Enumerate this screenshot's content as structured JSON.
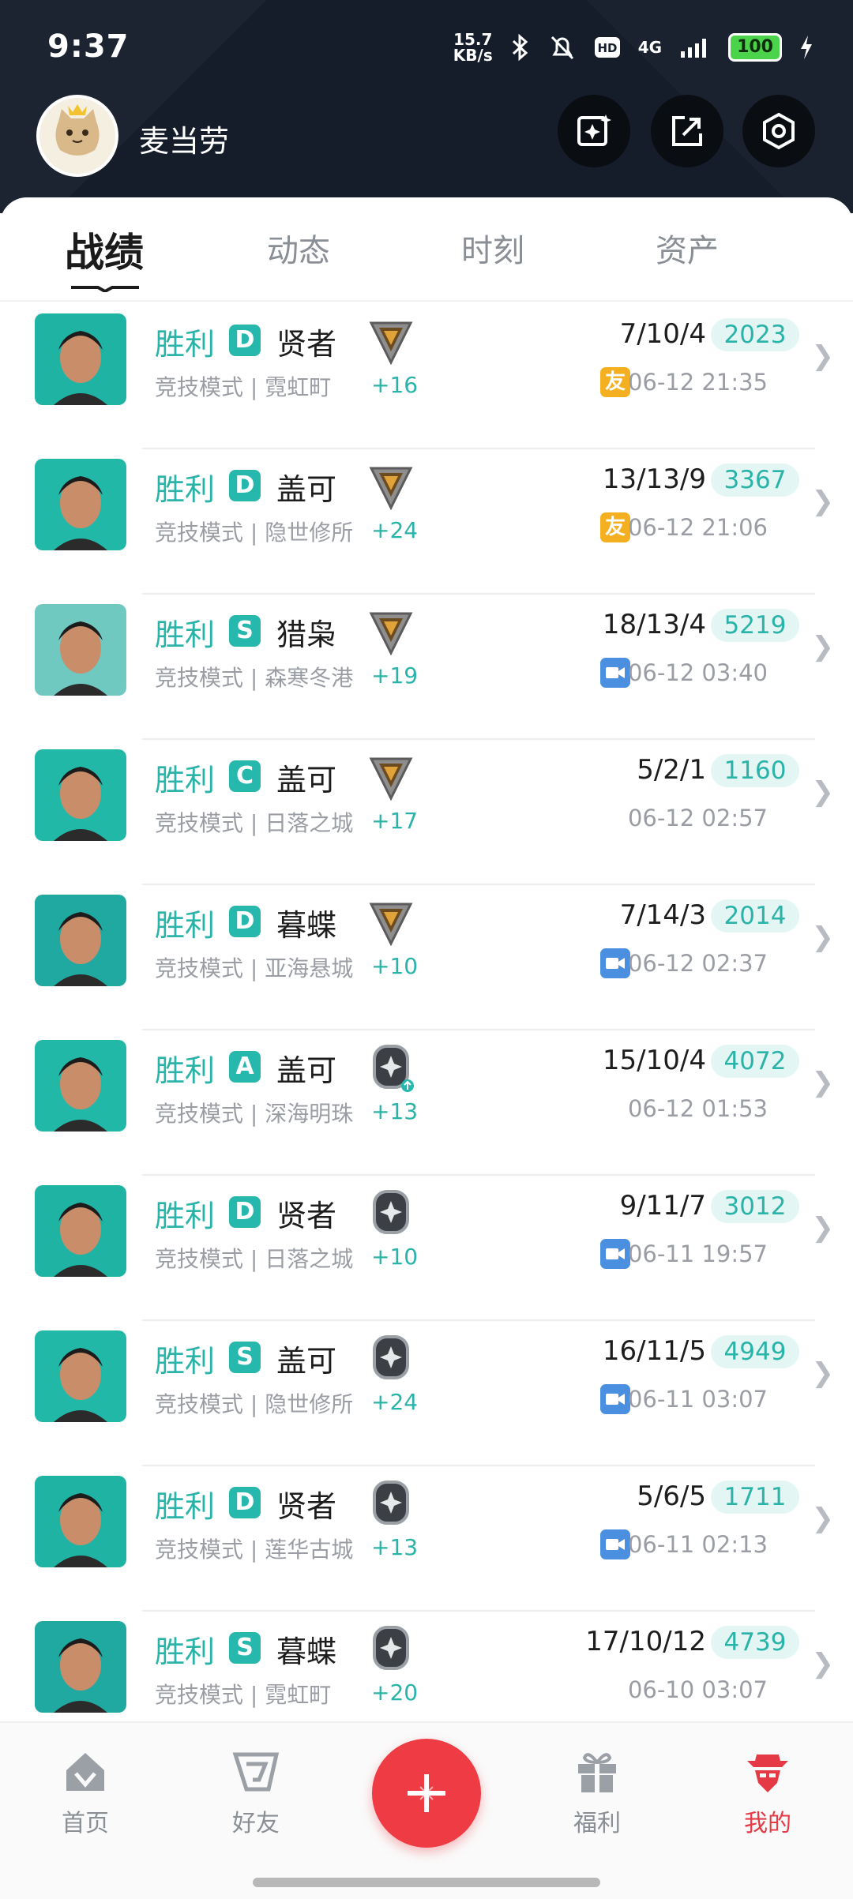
{
  "status": {
    "time": "9:37",
    "speed_value": "15.7",
    "speed_unit": "KB/s",
    "network": "4G",
    "battery": "100"
  },
  "profile": {
    "name": "麦当劳"
  },
  "tabs": [
    "战绩",
    "动态",
    "时刻",
    "资产"
  ],
  "matches": [
    {
      "result": "胜利",
      "grade": "D",
      "hero": "贤者",
      "mode": "竞技模式 | 霓虹町",
      "rank": "gold",
      "delta": "+16",
      "kda": "7/10/4",
      "score": "2023",
      "tag": "友",
      "tag_type": "friend",
      "time": "06-12 21:35",
      "hero_color": "#1fb3a3"
    },
    {
      "result": "胜利",
      "grade": "D",
      "hero": "盖可",
      "mode": "竞技模式 | 隐世修所",
      "rank": "gold",
      "delta": "+24",
      "kda": "13/13/9",
      "score": "3367",
      "tag": "友",
      "tag_type": "friend",
      "time": "06-12 21:06",
      "hero_color": "#22b8a8"
    },
    {
      "result": "胜利",
      "grade": "S",
      "hero": "猎枭",
      "mode": "竞技模式 | 森寒冬港",
      "rank": "gold",
      "delta": "+19",
      "kda": "18/13/4",
      "score": "5219",
      "tag": "",
      "tag_type": "video",
      "time": "06-12 03:40",
      "hero_color": "#6fc9c0"
    },
    {
      "result": "胜利",
      "grade": "C",
      "hero": "盖可",
      "mode": "竞技模式 | 日落之城",
      "rank": "gold",
      "delta": "+17",
      "kda": "5/2/1",
      "score": "1160",
      "tag": "",
      "tag_type": "none",
      "time": "06-12 02:57",
      "hero_color": "#22b8a8"
    },
    {
      "result": "胜利",
      "grade": "D",
      "hero": "暮蝶",
      "mode": "竞技模式 | 亚海悬城",
      "rank": "gold",
      "delta": "+10",
      "kda": "7/14/3",
      "score": "2014",
      "tag": "",
      "tag_type": "video",
      "time": "06-12 02:37",
      "hero_color": "#1fa9a0"
    },
    {
      "result": "胜利",
      "grade": "A",
      "hero": "盖可",
      "mode": "竞技模式 | 深海明珠",
      "rank": "silver-up",
      "delta": "+13",
      "kda": "15/10/4",
      "score": "4072",
      "tag": "",
      "tag_type": "none",
      "time": "06-12 01:53",
      "hero_color": "#22b8a8"
    },
    {
      "result": "胜利",
      "grade": "D",
      "hero": "贤者",
      "mode": "竞技模式 | 日落之城",
      "rank": "silver",
      "delta": "+10",
      "kda": "9/11/7",
      "score": "3012",
      "tag": "",
      "tag_type": "video",
      "time": "06-11 19:57",
      "hero_color": "#1fb3a3"
    },
    {
      "result": "胜利",
      "grade": "S",
      "hero": "盖可",
      "mode": "竞技模式 | 隐世修所",
      "rank": "silver",
      "delta": "+24",
      "kda": "16/11/5",
      "score": "4949",
      "tag": "",
      "tag_type": "video",
      "time": "06-11 03:07",
      "hero_color": "#22b8a8"
    },
    {
      "result": "胜利",
      "grade": "D",
      "hero": "贤者",
      "mode": "竞技模式 | 莲华古城",
      "rank": "silver",
      "delta": "+13",
      "kda": "5/6/5",
      "score": "1711",
      "tag": "",
      "tag_type": "video",
      "time": "06-11 02:13",
      "hero_color": "#1fb3a3"
    },
    {
      "result": "胜利",
      "grade": "S",
      "hero": "暮蝶",
      "mode": "竞技模式 | 霓虹町",
      "rank": "silver",
      "delta": "+20",
      "kda": "17/10/12",
      "score": "4739",
      "tag": "",
      "tag_type": "none",
      "time": "06-10 03:07",
      "hero_color": "#1fa9a0"
    }
  ],
  "nav": {
    "home": "首页",
    "friends": "好友",
    "welfare": "福利",
    "mine": "我的"
  },
  "colors": {
    "accent": "#2ab3a8",
    "active_nav": "#e53945",
    "fab": "#ef3b44"
  }
}
